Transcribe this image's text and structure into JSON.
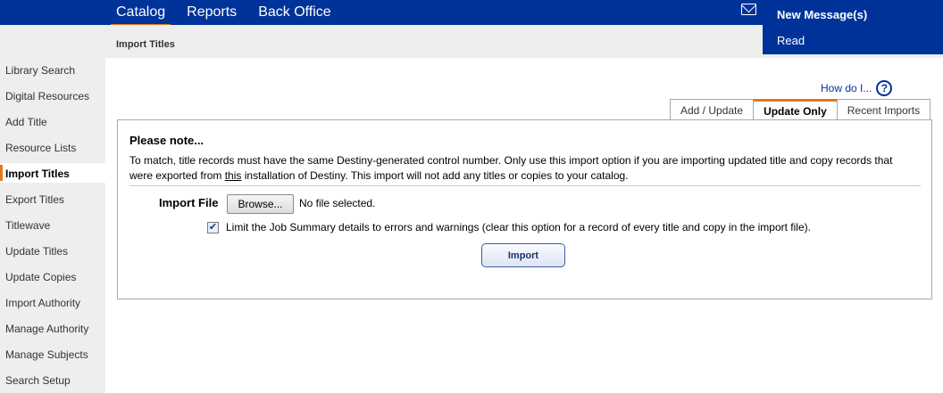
{
  "topnav": {
    "items": [
      {
        "label": "Catalog",
        "active": true
      },
      {
        "label": "Reports",
        "active": false
      },
      {
        "label": "Back Office",
        "active": false
      }
    ]
  },
  "messages": {
    "icon": "mail-icon",
    "title": "New Message(s)",
    "read_label": "Read"
  },
  "page": {
    "title": "Import Titles"
  },
  "sidebar": {
    "items": [
      {
        "label": "Library Search"
      },
      {
        "label": "Digital Resources"
      },
      {
        "label": "Add Title"
      },
      {
        "label": "Resource Lists"
      },
      {
        "label": "Import Titles",
        "active": true
      },
      {
        "label": "Export Titles"
      },
      {
        "label": "Titlewave"
      },
      {
        "label": "Update Titles"
      },
      {
        "label": "Update Copies"
      },
      {
        "label": "Import Authority"
      },
      {
        "label": "Manage Authority"
      },
      {
        "label": "Manage Subjects"
      },
      {
        "label": "Search Setup"
      }
    ]
  },
  "help": {
    "label": "How do I...",
    "icon_glyph": "?"
  },
  "tabs": [
    {
      "label": "Add / Update",
      "active": false
    },
    {
      "label": "Update Only",
      "active": true
    },
    {
      "label": "Recent Imports",
      "active": false
    }
  ],
  "note": {
    "title": "Please note...",
    "text_before": "To match, title records must have the same Destiny-generated control number. Only use this import option if you are importing updated title and copy records that were exported from ",
    "text_underlined": "this",
    "text_after": " installation of Destiny. This import will not add any titles or copies to your catalog."
  },
  "import_file": {
    "label": "Import File",
    "browse_label": "Browse...",
    "status": "No file selected."
  },
  "limit_option": {
    "checked": true,
    "check_glyph": "✔",
    "label": "Limit the Job Summary details to errors and warnings (clear this option for a record of every title and copy in the import file)."
  },
  "import_button": {
    "label": "Import"
  },
  "colors": {
    "brand_blue": "#003399",
    "accent_orange": "#e07b22",
    "sidebar_grey": "#eeeeee"
  }
}
